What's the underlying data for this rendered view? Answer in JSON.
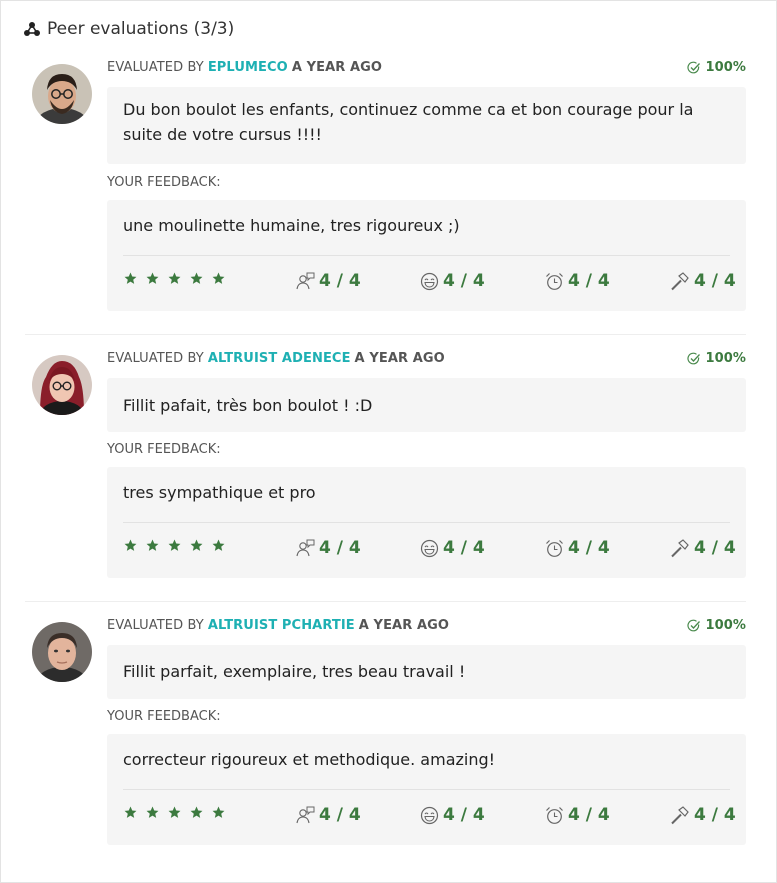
{
  "header": {
    "title": "Peer evaluations (3/3)"
  },
  "labels": {
    "evaluated_by": "EVALUATED BY",
    "your_feedback": "YOUR FEEDBACK:"
  },
  "colors": {
    "accent_teal": "#1eb0b3",
    "success_green": "#3c7a3f",
    "card_background": "#f5f5f5"
  },
  "evaluations": [
    {
      "evaluator": "EPLUMECO",
      "time": "A YEAR AGO",
      "score": "100%",
      "comment": "Du bon boulot les enfants, continuez comme ca et bon courage pour la suite de votre cursus !!!!",
      "feedback": "une moulinette humaine, tres rigoureux ;)",
      "stars": 5,
      "ratings": {
        "interest": "4 / 4",
        "nice": "4 / 4",
        "punctuality": "4 / 4",
        "rigor": "4 / 4"
      }
    },
    {
      "evaluator": "ALTRUIST ADENECE",
      "time": "A YEAR AGO",
      "score": "100%",
      "comment": "Fillit pafait, très bon boulot ! :D",
      "feedback": "tres sympathique et pro",
      "stars": 5,
      "ratings": {
        "interest": "4 / 4",
        "nice": "4 / 4",
        "punctuality": "4 / 4",
        "rigor": "4 / 4"
      }
    },
    {
      "evaluator": "ALTRUIST PCHARTIE",
      "time": "A YEAR AGO",
      "score": "100%",
      "comment": "Fillit parfait, exemplaire, tres beau travail !",
      "feedback": "correcteur rigoureux et methodique. amazing!",
      "stars": 5,
      "ratings": {
        "interest": "4 / 4",
        "nice": "4 / 4",
        "punctuality": "4 / 4",
        "rigor": "4 / 4"
      }
    }
  ],
  "icons": {
    "header": "peer-network-icon",
    "score": "check-circle-icon",
    "stars": "star-icon",
    "interest": "person-speech-icon",
    "nice": "smiley-icon",
    "punctuality": "alarm-clock-icon",
    "rigor": "hammer-icon"
  }
}
